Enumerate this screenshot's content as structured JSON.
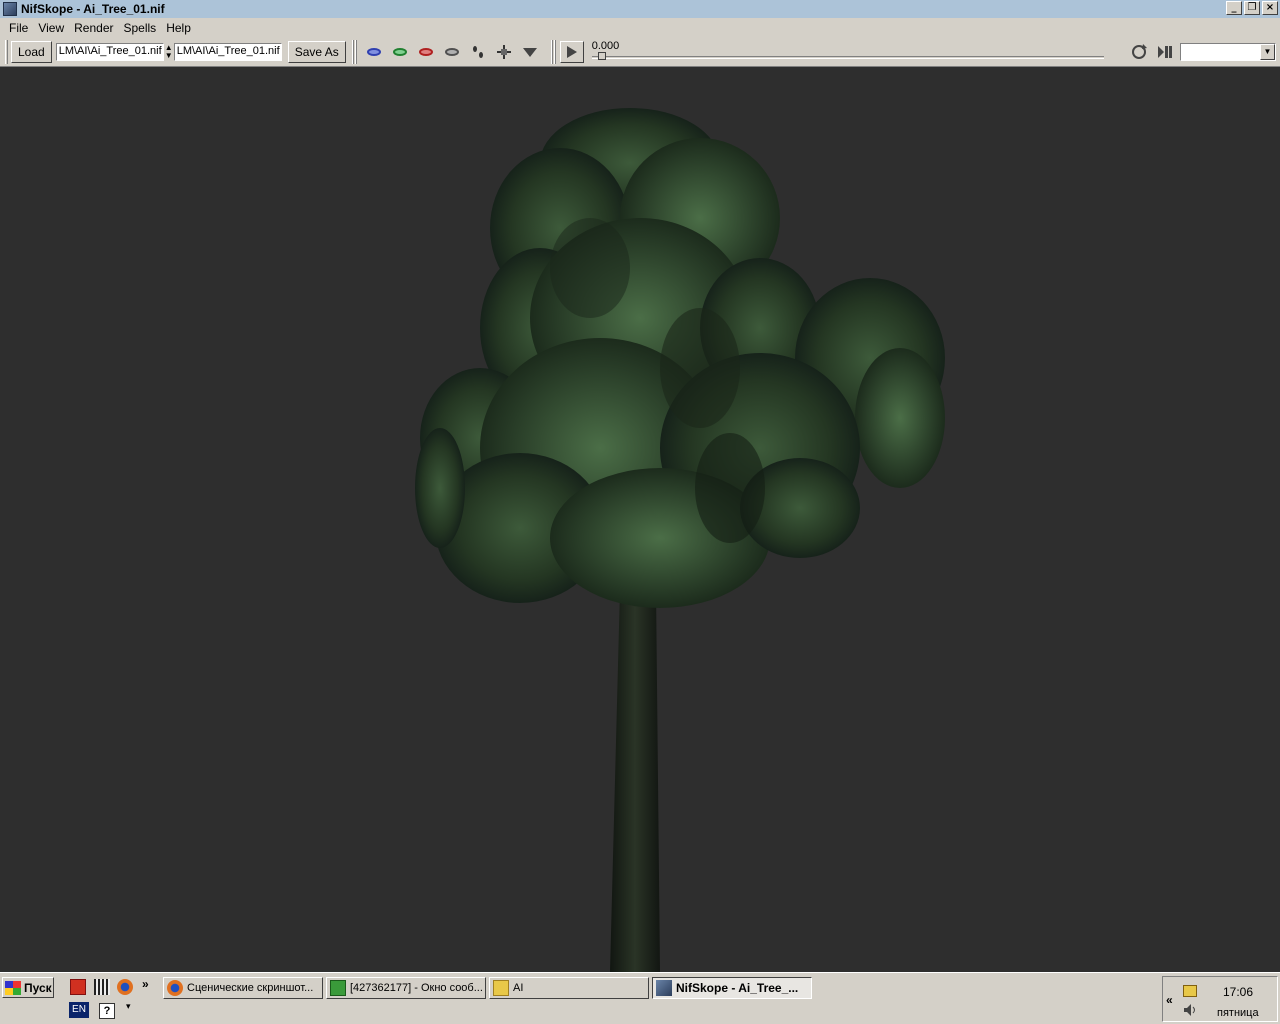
{
  "window": {
    "title": "NifSkope - Ai_Tree_01.nif",
    "buttons": {
      "minimize": "_",
      "maximize": "❐",
      "close": "×"
    }
  },
  "menu": [
    "File",
    "View",
    "Render",
    "Spells",
    "Help"
  ],
  "toolbar": {
    "load_label": "Load",
    "load_path": "LM\\AI\\Ai_Tree_01.nif",
    "save_path": "LM\\AI\\Ai_Tree_01.nif",
    "save_as_label": "Save As",
    "time_value": "0.000",
    "time_progress": 0.0,
    "animation_combo_value": ""
  },
  "taskbar": {
    "start_label": "Пуск",
    "tasks": [
      {
        "label": "Сценические скриншот...",
        "icon": "firefox-icon"
      },
      {
        "label": "[427362177] - Окно сооб...",
        "icon": "messenger-icon"
      },
      {
        "label": "AI",
        "icon": "folder-icon"
      },
      {
        "label": "NifSkope - Ai_Tree_...",
        "icon": "nifskope-icon",
        "active": true
      }
    ],
    "lang": "EN",
    "clock": "17:06",
    "day": "пятница"
  }
}
